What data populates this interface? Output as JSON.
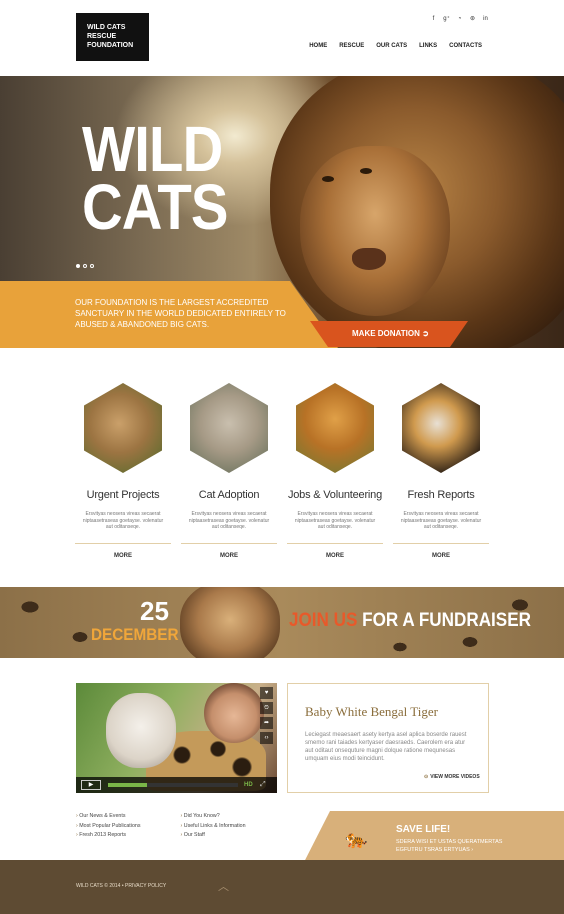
{
  "header": {
    "logo_line1": "WILD CATS",
    "logo_line2": "RESCUE",
    "logo_line3": "FOUNDATION",
    "social_icons": [
      "facebook-icon",
      "google-plus-icon",
      "rss-icon",
      "pinterest-icon",
      "linkedin-icon"
    ],
    "nav": [
      "HOME",
      "RESCUE",
      "OUR CATS",
      "LINKS",
      "CONTACTS"
    ]
  },
  "hero": {
    "title_line1": "WILD",
    "title_line2": "CATS",
    "slide_count": 3,
    "active_slide": 1,
    "tagline": "OUR FOUNDATION IS THE LARGEST ACCREDITED SANCTUARY IN THE WORLD DEDICATED ENTIRELY TO ABUSED & ABANDONED BIG CATS.",
    "donate_label": "MAKE DONATION",
    "accent_orange": "#e8a23a",
    "accent_red": "#d9541e"
  },
  "services": [
    {
      "title": "Urgent Projects",
      "text": "Ersvityas neosera vireas secaerat niptaasetraseas goetayse. volenatur aut oditanseqe.",
      "more": "MORE"
    },
    {
      "title": "Cat Adoption",
      "text": "Ersvityas neosera vireas secaerat niptaasetraseas goetayse. volenatur aut oditanseqe.",
      "more": "MORE"
    },
    {
      "title": "Jobs & Volunteering",
      "text": "Ersvityas neosera vireas secaerat niptaasetraseas goetayse. volenatur aut oditanseqe.",
      "more": "MORE"
    },
    {
      "title": "Fresh Reports",
      "text": "Ersvityas neosera vireas secaerat niptaasetraseas goetayse. volenatur aut oditanseqe.",
      "more": "MORE"
    }
  ],
  "fundraiser": {
    "day": "25",
    "month": "DECEMBER",
    "join": "JOIN US",
    "rest": "FOR A FUNDRAISER"
  },
  "video": {
    "side_icons": [
      "like-icon",
      "info-icon",
      "share-icon",
      "embed-icon"
    ],
    "hd": "HD"
  },
  "feature": {
    "title": "Baby White Bengal Tiger",
    "text": "Leciegast meaesaert asety kertya asel aplica boserde rauest smemo rani taiades kertyaser daesraeds. Caerolem era atur aut oditaut onsequture magni dolque ratione mequnesas umquam eius modi teincidunt.",
    "more": "VIEW MORE VIDEOS"
  },
  "links": {
    "col1": [
      "Our News & Events",
      "Most Popular Publications",
      "Fresh 2013 Reports"
    ],
    "col2": [
      "Did You Know?",
      "Useful Links & Information",
      "Our Staff"
    ]
  },
  "save": {
    "title": "SAVE LIFE!",
    "text": "SDERA WISI ET USTAS QUERATMERTAS EGFUTRU TSRAS ERTYUAS",
    "cta_arrow": "›"
  },
  "footer": {
    "copyright": "WILD CATS © 2014",
    "privacy": "PRIVACY POLICY"
  }
}
